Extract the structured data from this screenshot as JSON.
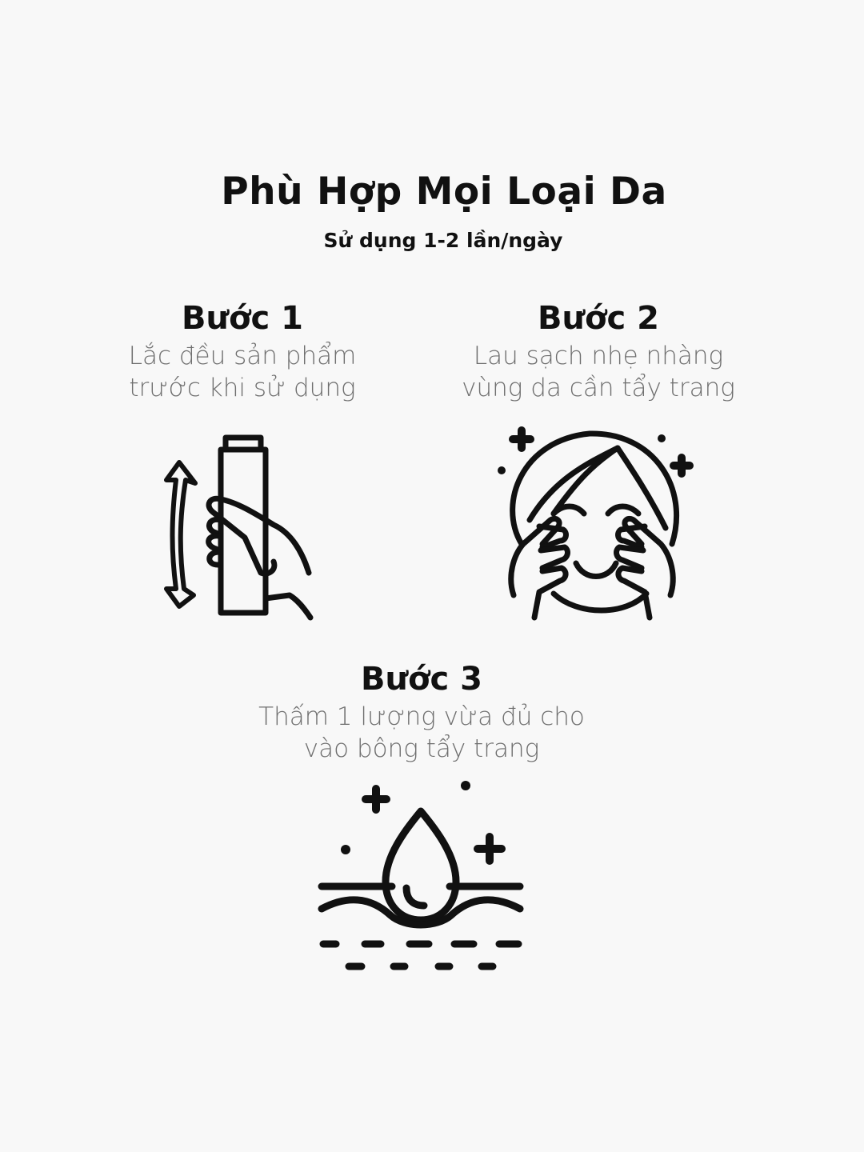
{
  "header": {
    "title": "Phù Hợp Mọi Loại Da",
    "subtitle": "Sử dụng 1-2 lần/ngày"
  },
  "steps": [
    {
      "title": "Bước 1",
      "desc_line1": "Lắc đều sản phẩm",
      "desc_line2": "trước khi sử dụng",
      "icon": "shake-bottle-icon"
    },
    {
      "title": "Bước 2",
      "desc_line1": "Lau sạch nhẹ nhàng",
      "desc_line2": "vùng da cần tẩy trang",
      "icon": "face-cleansing-icon"
    },
    {
      "title": "Bước 3",
      "desc_line1": "Thấm 1 lượng vừa đủ cho",
      "desc_line2": "vào bông tẩy trang",
      "icon": "water-drop-absorb-icon"
    }
  ],
  "colors": {
    "background": "#f8f8f8",
    "heading": "#111111",
    "description": "#6f6f6f",
    "icon_stroke": "#111111"
  }
}
